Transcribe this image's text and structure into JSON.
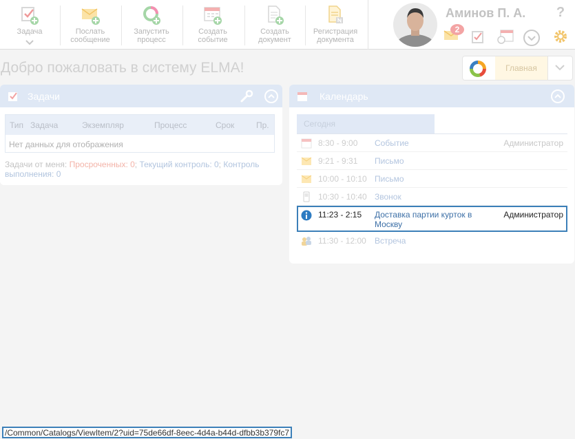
{
  "toolbar": {
    "task_label": "Задача",
    "send_message_label": "Послать сообщение",
    "start_process_label": "Запустить процесс",
    "create_event_label": "Создать событие",
    "create_document_label": "Создать документ",
    "register_document_label": "Регистрация документа"
  },
  "user": {
    "name": "Аминов П. А.",
    "messages_count": "2",
    "help_label": "?"
  },
  "header": {
    "welcome": "Добро пожаловать в систему ELMA!",
    "home_label": "Главная"
  },
  "tasks": {
    "title": "Задачи",
    "columns": [
      "Тип",
      "Задача",
      "Экземпляр",
      "Процесс",
      "Срок",
      "Пр."
    ],
    "empty": "Нет данных для отображения",
    "footer_prefix": "Задачи от меня: ",
    "overdue_label": "Просроченных: 0",
    "control_label": "Текущий контроль: 0",
    "execution_label": "Контроль выполнения: 0"
  },
  "calendar": {
    "title": "Календарь",
    "today_label": "Сегодня",
    "rows": [
      {
        "time": "8:30 - 9:00",
        "title": "Событие",
        "who": "Администратор",
        "icon": "calendar-icon"
      },
      {
        "time": "9:21 - 9:31",
        "title": "Письмо",
        "who": "",
        "icon": "envelope-icon"
      },
      {
        "time": "10:00 - 10:10",
        "title": "Письмо",
        "who": "",
        "icon": "envelope-icon"
      },
      {
        "time": "10:30 - 10:40",
        "title": "Звонок",
        "who": "",
        "icon": "phone-icon"
      },
      {
        "time": "11:23 - 2:15",
        "title": "Доставка партии курток в Москву",
        "who": "Администратор",
        "icon": "info-icon"
      },
      {
        "time": "11:30 - 12:00",
        "title": "Встреча",
        "who": "",
        "icon": "meeting-icon"
      }
    ]
  },
  "status_bar": {
    "url": "/Common/Catalogs/ViewItem/2?uid=75de66df-8eec-4d4a-b44d-dfbb3b379fc7"
  },
  "colors": {
    "accent_blue": "#3b7fb8",
    "panel_header": "#dfe8f5",
    "overdue_red": "#f3b3a8"
  }
}
